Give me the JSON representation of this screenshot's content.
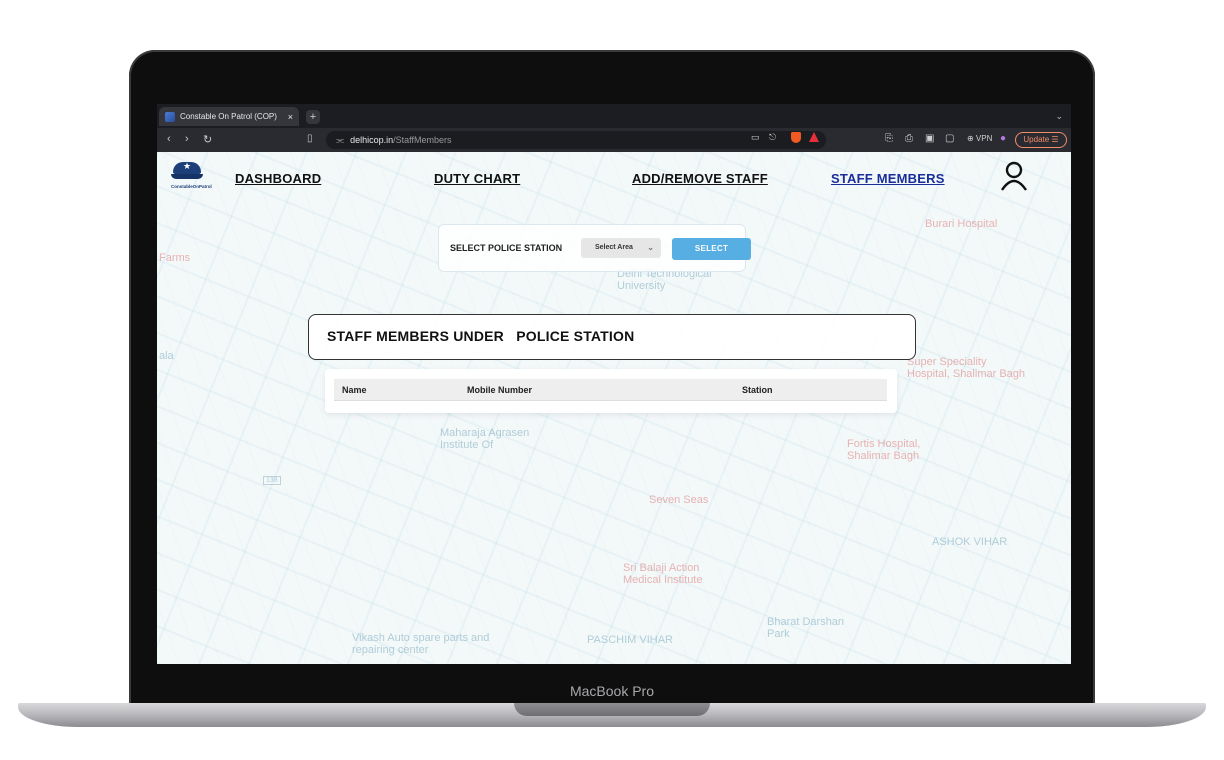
{
  "device": {
    "brand": "MacBook Pro"
  },
  "browser": {
    "tab_title": "Constable On Patrol (COP)",
    "tab_close": "×",
    "new_tab": "+",
    "tab_menu": "⌄",
    "url_domain": "delhicop.in",
    "url_path": "/StaffMembers",
    "vpn_label": "⊕ VPN",
    "update_label": "Update ☰"
  },
  "site": {
    "logo_text": "ConstableOnPatrol",
    "nav": {
      "dashboard": "DASHBOARD",
      "duty_chart": "DUTY CHART",
      "add_remove_staff": "ADD/REMOVE STAFF",
      "staff_members": "STAFF MEMBERS"
    },
    "selector": {
      "label": "SELECT POLICE STATION",
      "select_value": "Select Area",
      "button": "SELECT"
    },
    "heading": "STAFF MEMBERS UNDER   POLICE STATION",
    "table": {
      "columns": [
        "Name",
        "Mobile Number",
        "Station"
      ]
    }
  },
  "map_labels": {
    "burari": "Burari Hospital",
    "dtu": "Delhi Technological University",
    "maharaja": "Maharaja Agrasen Institute Of",
    "seven_seas": "Seven Seas",
    "fortis": "Fortis Hospital, Shalimar Bagh",
    "super_spec": "Super Speciality Hospital, Shalimar Bagh",
    "sri_balaji": "Sri Balaji Action Medical Institute",
    "paschim": "PASCHIM VIHAR",
    "ashok": "ASHOK VIHAR",
    "vikash": "Vikash Auto spare parts and repairing center",
    "bharat": "Bharat Darshan Park",
    "farms": "Farms",
    "ala": "ala",
    "road": "138"
  },
  "colors": {
    "nav_active": "#1a2e9a",
    "select_button": "#56aee3",
    "logo_blue": "#1c3f7a"
  }
}
